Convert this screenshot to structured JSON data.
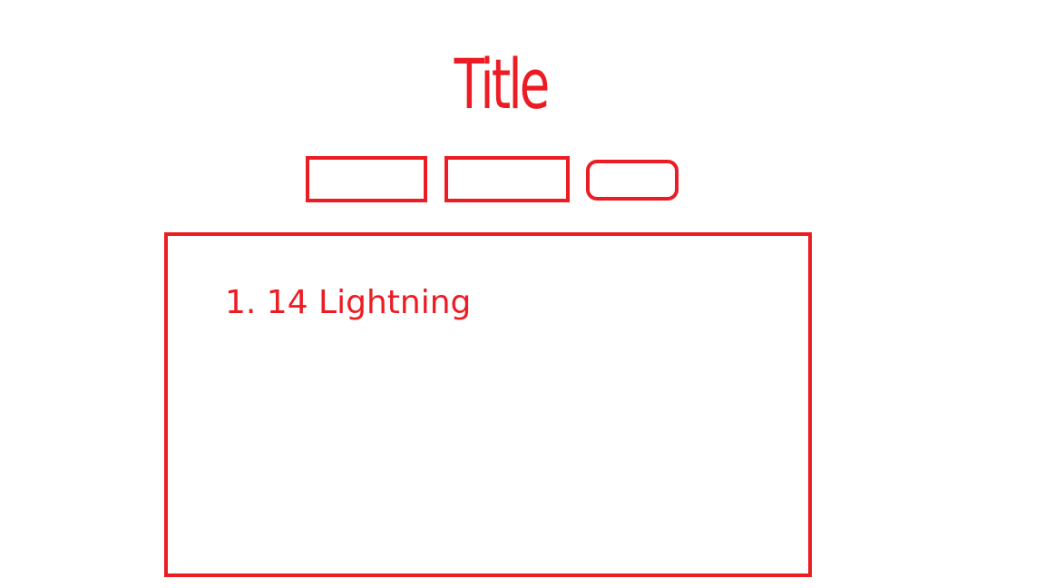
{
  "header": {
    "title": "Title"
  },
  "toolbar": {
    "buttons": [
      {
        "label": ""
      },
      {
        "label": ""
      },
      {
        "label": ""
      }
    ]
  },
  "main": {
    "list": {
      "items": [
        {
          "text": "1. 14 Lightning"
        }
      ]
    }
  },
  "colors": {
    "accent": "#ec1c24",
    "background": "#ffffff"
  }
}
